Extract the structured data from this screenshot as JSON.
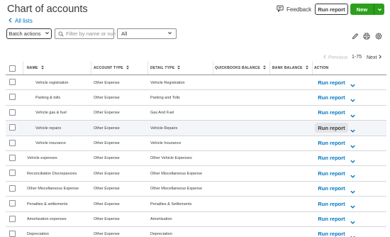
{
  "header": {
    "title": "Chart of accounts",
    "back_link": "All lists",
    "feedback_label": "Feedback",
    "run_report_label": "Run report",
    "new_label": "New"
  },
  "toolbar": {
    "batch_actions_label": "Batch actions",
    "search_placeholder": "Filter by name or number",
    "filter_value": "All",
    "icons": [
      "edit-icon",
      "print-icon",
      "settings-icon"
    ]
  },
  "pagination": {
    "previous_label": "Previous",
    "range_label": "1-75",
    "next_label": "Next"
  },
  "table": {
    "columns": {
      "name": "NAME",
      "account_type": "ACCOUNT TYPE",
      "detail_type": "DETAIL TYPE",
      "quickbooks_balance": "QUICKBOOKS BALANCE",
      "bank_balance": "BANK BALANCE",
      "action": "ACTION"
    },
    "rows": [
      {
        "name": "Vehicle registration",
        "account_type": "Other Expense",
        "detail_type": "Vehicle Registration",
        "action": "Run report"
      },
      {
        "name": "Parking & tolls",
        "account_type": "Other Expense",
        "detail_type": "Parking and Tolls",
        "action": "Run report"
      },
      {
        "name": "Vehicle gas & fuel",
        "account_type": "Other Expense",
        "detail_type": "Gas And Fuel",
        "action": "Run report"
      },
      {
        "name": "Vehicle repairs",
        "account_type": "Other Expense",
        "detail_type": "Vehicle Repairs",
        "action": "Run report"
      },
      {
        "name": "Vehicle insurance",
        "account_type": "Other Expense",
        "detail_type": "Vehicle Insurance",
        "action": "Run report"
      },
      {
        "name": "Vehicle expenses",
        "account_type": "Other Expense",
        "detail_type": "Other Vehicle Expenses",
        "action": "Run report"
      },
      {
        "name": "Reconciliation Discrepancies",
        "account_type": "Other Expense",
        "detail_type": "Other Miscellaneous Expense",
        "action": "Run report"
      },
      {
        "name": "Other Miscellaneous Expense",
        "account_type": "Other Expense",
        "detail_type": "Other Miscellaneous Expense",
        "action": "Run report"
      },
      {
        "name": "Penalties & settlements",
        "account_type": "Other Expense",
        "detail_type": "Penalties & Settlements",
        "action": "Run report"
      },
      {
        "name": "Amortization expenses",
        "account_type": "Other Expense",
        "detail_type": "Amortization",
        "action": "Run report"
      },
      {
        "name": "Depreciation",
        "account_type": "Other Expense",
        "detail_type": "Depreciation",
        "action": "Run report"
      }
    ]
  },
  "colors": {
    "link_blue": "#0077c5",
    "brand_green": "#2ca01c",
    "text_dark": "#393a3d"
  }
}
